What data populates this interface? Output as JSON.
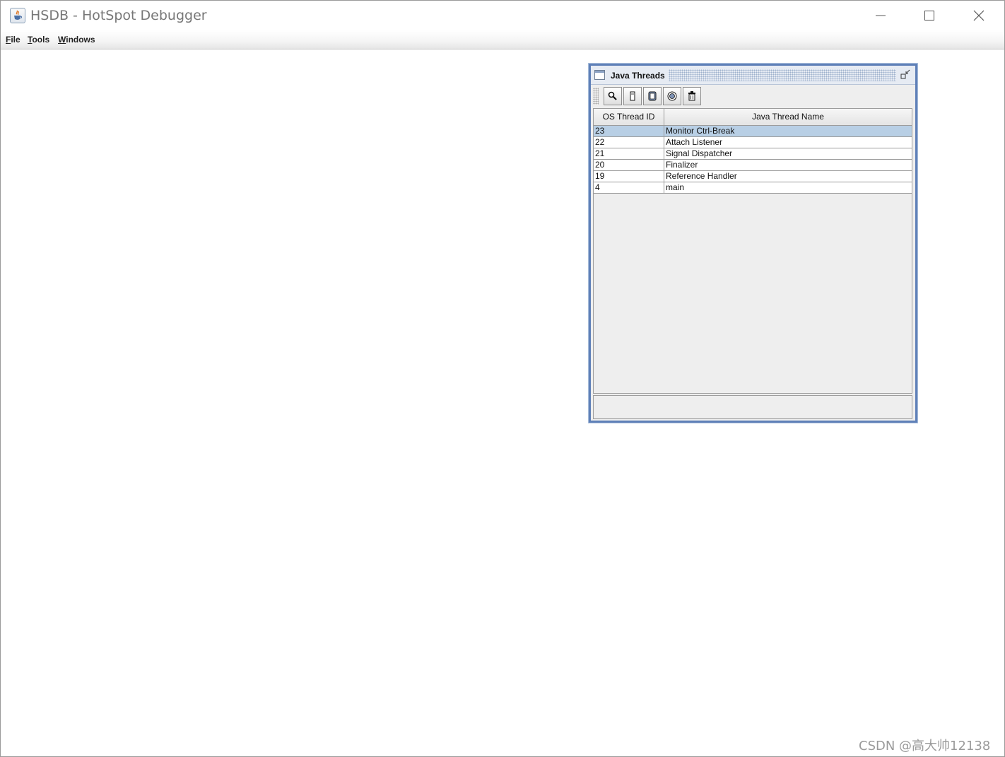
{
  "window": {
    "title": "HSDB - HotSpot Debugger",
    "app_icon": "java-icon",
    "controls": {
      "minimize_icon": "minimize-icon",
      "maximize_icon": "maximize-icon",
      "close_icon": "close-icon"
    }
  },
  "menubar": {
    "items": [
      {
        "mnemonic": "F",
        "rest": "ile"
      },
      {
        "mnemonic": "T",
        "rest": "ools"
      },
      {
        "mnemonic": "W",
        "rest": "indows"
      }
    ]
  },
  "java_threads": {
    "title": "Java Threads",
    "toolbar_icons": [
      "inspect-thread-icon",
      "stack-memory-icon",
      "thread-info-icon",
      "find-crashes-icon",
      "delete-icon"
    ],
    "columns": [
      "OS Thread ID",
      "Java Thread Name"
    ],
    "rows": [
      {
        "id": "23",
        "name": "Monitor Ctrl-Break",
        "selected": true
      },
      {
        "id": "22",
        "name": "Attach Listener",
        "selected": false
      },
      {
        "id": "21",
        "name": "Signal Dispatcher",
        "selected": false
      },
      {
        "id": "20",
        "name": "Finalizer",
        "selected": false
      },
      {
        "id": "19",
        "name": "Reference Handler",
        "selected": false
      },
      {
        "id": "4",
        "name": "main",
        "selected": false
      }
    ]
  },
  "watermark": "CSDN @高大帅12138",
  "colors": {
    "frame_border": "#5f80b8",
    "selected_row": "#b8cfe5"
  }
}
